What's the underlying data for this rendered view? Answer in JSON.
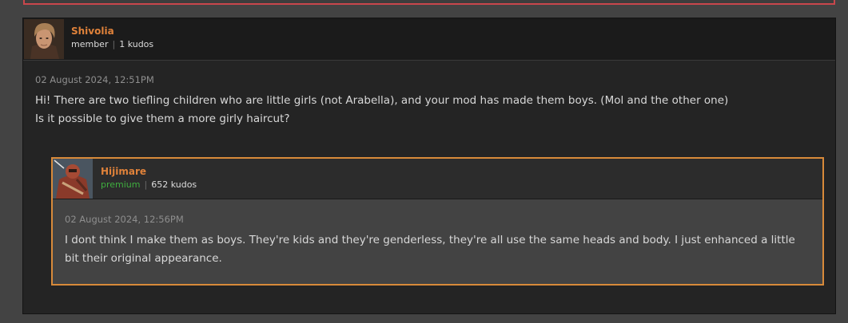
{
  "comment": {
    "author": {
      "name": "Shivolia",
      "role": "member",
      "kudos": "1 kudos"
    },
    "date": "02 August 2024, 12:51PM",
    "text_lines": [
      "Hi! There are two tiefling children who are little girls (not Arabella), and your mod has made them boys. (Mol and the other one)",
      "Is it possible to give them a more girly haircut?"
    ]
  },
  "reply": {
    "author": {
      "name": "Hijimare",
      "role": "premium",
      "kudos": "652 kudos"
    },
    "date": "02 August 2024, 12:56PM",
    "text": "I dont think I make them as boys. They're kids and they're genderless, they're all use the same heads and body. I just enhanced a little bit their original appearance."
  },
  "colors": {
    "author_name": "#e0823a",
    "premium": "#3fae3f",
    "reply_border": "#d88a3a",
    "previous_post_border": "#c9474c"
  }
}
